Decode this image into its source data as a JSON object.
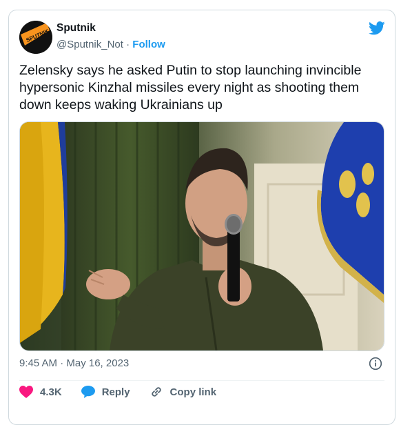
{
  "account": {
    "name": "Sputnik",
    "handle": "@Sputnik_Not",
    "separator": "·",
    "follow_label": "Follow",
    "avatar_text": "SPUTNIK NOT"
  },
  "tweet": {
    "text": "Zelensky says he asked Putin to stop launching invincible hypersonic Kinzhal missiles every night as shooting them down keeps waking Ukrainians up"
  },
  "media": {
    "icon": "photo-zelensky-with-microphone"
  },
  "meta": {
    "timestamp": "9:45 AM · May 16, 2023"
  },
  "actions": {
    "like_count": "4.3K",
    "reply_label": "Reply",
    "copy_link_label": "Copy link"
  },
  "colors": {
    "brand_blue": "#1d9bf0",
    "like_red": "#f91880",
    "avatar_orange": "#f7931e"
  }
}
